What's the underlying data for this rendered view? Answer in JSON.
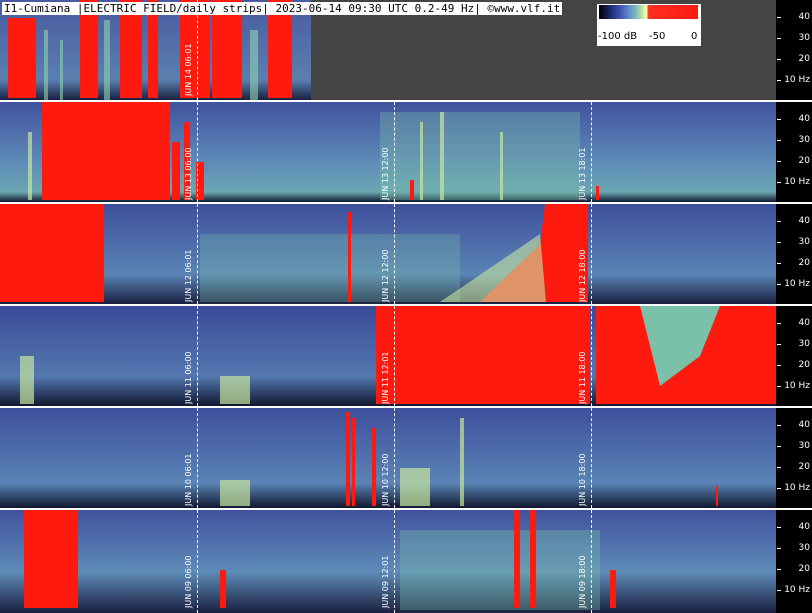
{
  "header": {
    "title": "I1-Cumiana |ELECTRIC FIELD/daily strips| 2023-06-14 09:30 UTC 0.2-49 Hz| ©www.vlf.it"
  },
  "colorbar": {
    "labels": [
      "-100 dB",
      "-50",
      "0"
    ]
  },
  "y_axis": {
    "ticks": [
      "40",
      "30",
      "20",
      "10 Hz"
    ]
  },
  "colors": {
    "background": "#3b4c96",
    "saturated": "#ff1a10",
    "axis": "#000000",
    "empty": "#444444"
  },
  "strips": [
    {
      "day": "JUN 14",
      "labels": [
        "JUN 14 06:01"
      ]
    },
    {
      "day": "JUN 13",
      "labels": [
        "JUN 13 06:00",
        "JUN 13 12:00",
        "JUN 13 18:01"
      ]
    },
    {
      "day": "JUN 12",
      "labels": [
        "JUN 12 06:01",
        "JUN 12 12:00",
        "JUN 12 18:00"
      ]
    },
    {
      "day": "JUN 11",
      "labels": [
        "JUN 11 06:00",
        "JUN 11 12:01",
        "JUN 11 18:00"
      ]
    },
    {
      "day": "JUN 10",
      "labels": [
        "JUN 10 06:01",
        "JUN 10 12:00",
        "JUN 10 18:00"
      ]
    },
    {
      "day": "JUN 09",
      "labels": [
        "JUN 09 06:00",
        "JUN 09 12:01",
        "JUN 09 18:00"
      ]
    }
  ]
}
